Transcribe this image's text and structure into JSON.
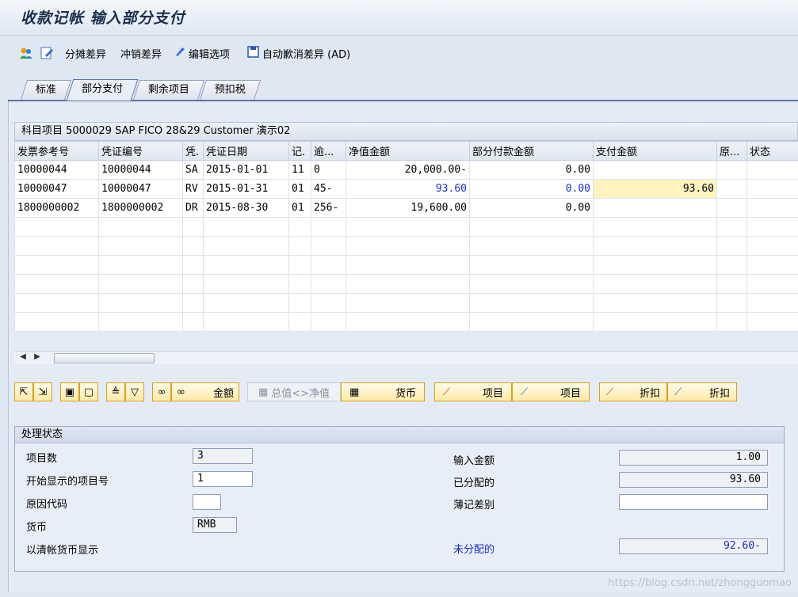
{
  "title": "收款记帐 输入部分支付",
  "toolbar": {
    "items": [
      {
        "icon": "person-icon"
      },
      {
        "icon": "edit-icon"
      },
      {
        "label": "分摊差异"
      },
      {
        "label": "冲销差异"
      },
      {
        "label": "编辑选项",
        "icon": "pencil-icon"
      },
      {
        "label": "自动歉消差异 (AD)",
        "icon": "save-icon"
      }
    ]
  },
  "tabs": [
    "标准",
    "部分支付",
    "剩余项目",
    "预扣税"
  ],
  "active_tab": "部分支付",
  "table": {
    "title": "科目项目 5000029 SAP FICO 28&29 Customer 演示02",
    "columns": [
      "发票参考号",
      "凭证编号",
      "凭.",
      "凭证日期",
      "记.",
      "逾...",
      "净值金额",
      "部分付款金额",
      "支付金额",
      "原...",
      "状态"
    ],
    "rows": [
      [
        "10000044",
        "10000044",
        "SA",
        "2015-01-01",
        "11",
        "0",
        "20,000.00-",
        "0.00",
        "",
        "",
        ""
      ],
      [
        "10000047",
        "10000047",
        "RV",
        "2015-01-31",
        "01",
        "45-",
        "93.60",
        "0.00",
        "93.60",
        "",
        ""
      ],
      [
        "1800000002",
        "1800000002",
        "DR",
        "2015-08-30",
        "01",
        "256-",
        "19,600.00",
        "0.00",
        "",
        "",
        ""
      ]
    ],
    "empty_rows": 6
  },
  "buttons": {
    "amount": "金额",
    "gross_net": "总值<>净值",
    "currency": "货币",
    "item1": "项目",
    "item2": "项目",
    "discount1": "折扣",
    "discount2": "折扣"
  },
  "status": {
    "heading": "处理状态",
    "item_count_label": "项目数",
    "item_count": "3",
    "first_item_label": "开始显示的项目号",
    "first_item": "1",
    "reason_code_label": "原因代码",
    "reason_code": "",
    "currency_label": "货币",
    "currency": "RMB",
    "clearing_currency_label": "以清帐货币显示",
    "entered_amount_label": "输入金额",
    "entered_amount": "1.00",
    "assigned_label": "已分配的",
    "assigned": "93.60",
    "difference_label": "薄记差别",
    "difference": "",
    "not_assigned_label": "未分配的",
    "not_assigned": "92.60-"
  },
  "watermark": "https://blog.csdn.net/zhongguomao"
}
